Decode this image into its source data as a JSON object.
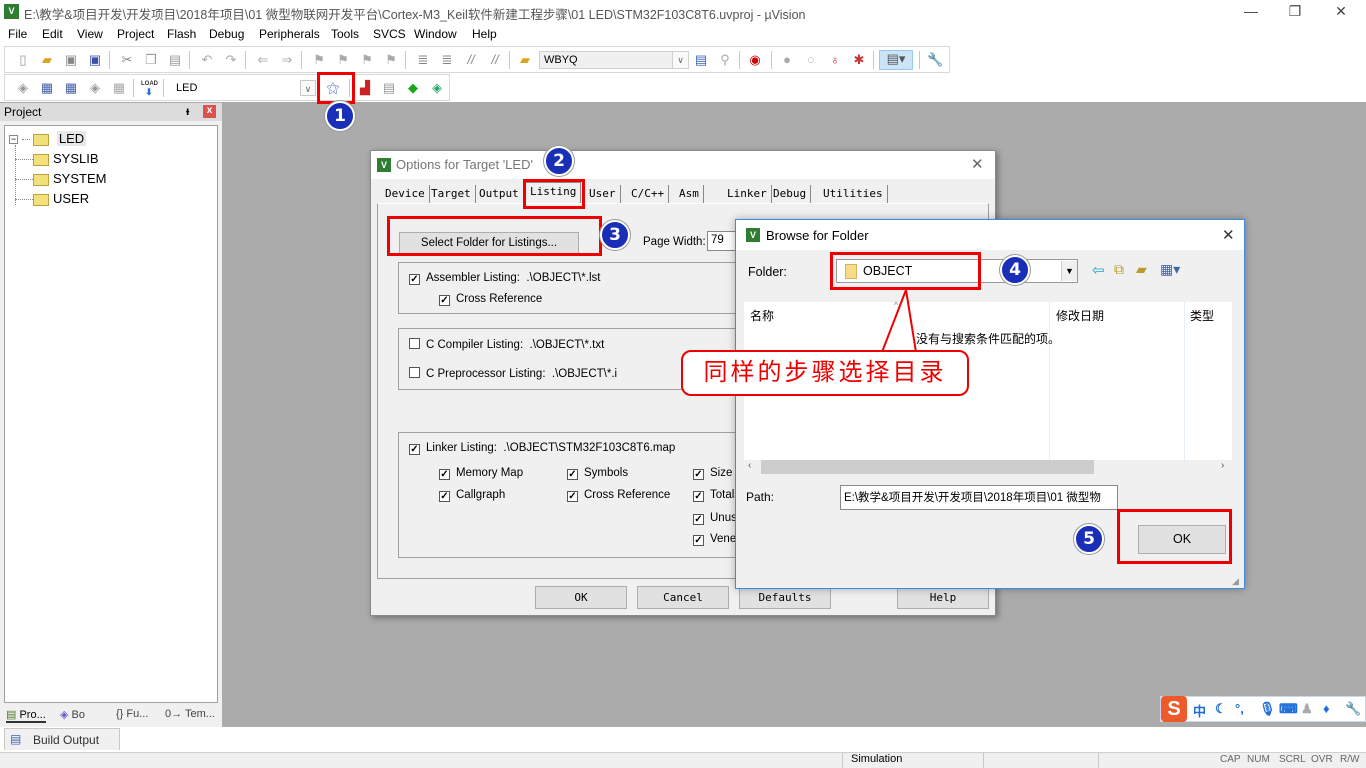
{
  "window": {
    "title": "E:\\教学&项目开发\\开发项目\\2018年项目\\01 微型物联网开发平台\\Cortex-M3_Keil软件新建工程步骤\\01 LED\\STM32F103C8T6.uvproj - µVision",
    "app_icon": "uvision-icon",
    "controls": {
      "minimize": "—",
      "restore": "❐",
      "close": "✕"
    }
  },
  "menu": [
    "File",
    "Edit",
    "View",
    "Project",
    "Flash",
    "Debug",
    "Peripherals",
    "Tools",
    "SVCS",
    "Window",
    "Help"
  ],
  "toolbar": {
    "find_combo": "WBYQ",
    "target_combo": "LED",
    "icons_row1": [
      "new-file-icon",
      "open-folder-icon",
      "save-icon",
      "save-all-icon",
      "cut-icon",
      "copy-icon",
      "paste-icon",
      "undo-icon",
      "redo-icon",
      "nav-back-icon",
      "nav-forward-icon",
      "bookmark-icon",
      "bookmark-prev-icon",
      "bookmark-next-icon",
      "bookmark-clear-icon",
      "indent-icon",
      "unindent-icon",
      "comment-icon",
      "uncomment-icon",
      "find-in-files-icon"
    ],
    "icons_row1_right": [
      "incremental-find-icon",
      "debug-session-icon",
      "breakpoint-insert-icon",
      "breakpoint-enable-icon",
      "breakpoint-disable-icon",
      "breakpoint-kill-icon",
      "window-layout-icon",
      "configure-icon"
    ],
    "icons_row2": [
      "translate-icon",
      "build-icon",
      "rebuild-icon",
      "batch-build-icon",
      "stop-build-icon",
      "load-download-icon"
    ],
    "load_label": "LOAD",
    "icons_row2_right": [
      "options-for-target-icon",
      "manage-components-icon",
      "file-extensions-icon",
      "run-time-env-icon",
      "pack-installer-icon"
    ]
  },
  "project_panel": {
    "title": "Project",
    "pin": "ᵻ",
    "close": "x",
    "tree": {
      "root": "LED",
      "groups": [
        "SYSLIB",
        "SYSTEM",
        "USER"
      ]
    },
    "tabs": [
      "Pro...",
      "Bo",
      "{} Fu...",
      "0→ Tem..."
    ]
  },
  "build_output": {
    "tab_label": "Build Output"
  },
  "statusbar": {
    "mode": "Simulation",
    "indicators": [
      "CAP",
      "NUM",
      "SCRL",
      "OVR",
      "R/W"
    ]
  },
  "options_dialog": {
    "title": "Options for Target 'LED'",
    "close": "✕",
    "tabs": [
      "Device",
      "Target",
      "Output",
      "Listing",
      "User",
      "C/C++",
      "Asm",
      "Linker",
      "Debug",
      "Utilities"
    ],
    "active_tab": "Listing",
    "select_folder_button": "Select Folder for Listings...",
    "page_width_label": "Page Width:",
    "page_width_value": "79",
    "assembler_listing": {
      "label": "Assembler Listing:",
      "path": ".\\OBJECT\\*.lst",
      "checked": true
    },
    "cross_reference": {
      "label": "Cross Reference",
      "checked": true
    },
    "c_compiler_listing": {
      "label": "C Compiler Listing:",
      "path": ".\\OBJECT\\*.txt",
      "checked": false
    },
    "c_preprocessor_listing": {
      "label": "C Preprocessor Listing:",
      "path": ".\\OBJECT\\*.i",
      "checked": false
    },
    "linker_listing": {
      "label": "Linker Listing:",
      "path": ".\\OBJECT\\STM32F103C8T6.map",
      "checked": true
    },
    "linker_options": [
      {
        "label": "Memory Map",
        "checked": true
      },
      {
        "label": "Symbols",
        "checked": true
      },
      {
        "label": "Size I",
        "checked": true
      },
      {
        "label": "Callgraph",
        "checked": true
      },
      {
        "label": "Cross Reference",
        "checked": true
      },
      {
        "label": "Totals",
        "checked": true
      },
      {
        "label": "Unus",
        "checked": true
      },
      {
        "label": "Vene",
        "checked": true
      }
    ],
    "buttons": {
      "ok": "OK",
      "cancel": "Cancel",
      "defaults": "Defaults",
      "help": "Help"
    }
  },
  "browse_dialog": {
    "title": "Browse for Folder",
    "close": "✕",
    "folder_label": "Folder:",
    "folder_value": "OBJECT",
    "columns": [
      "名称",
      "修改日期",
      "类型"
    ],
    "empty_message": "没有与搜索条件匹配的项。",
    "path_label": "Path:",
    "path_value": "E:\\教学&项目开发\\开发项目\\2018年项目\\01 微型物",
    "ok_button": "OK",
    "toolbar_icons": [
      "back-arrow-icon",
      "up-folder-icon",
      "new-folder-icon",
      "view-menu-icon"
    ]
  },
  "annotations": {
    "steps": [
      "1",
      "2",
      "3",
      "4",
      "5"
    ],
    "callout_text": "同样的步骤选择目录",
    "color": "#e00000",
    "step_color": "#1a2fb8"
  },
  "ime_bar": {
    "logo": "S",
    "mode": "中",
    "icons": [
      "moon-icon",
      "punctuation-icon",
      "microphone-icon",
      "keyboard-icon",
      "user-icon",
      "skin-icon",
      "settings-wrench-icon"
    ]
  }
}
